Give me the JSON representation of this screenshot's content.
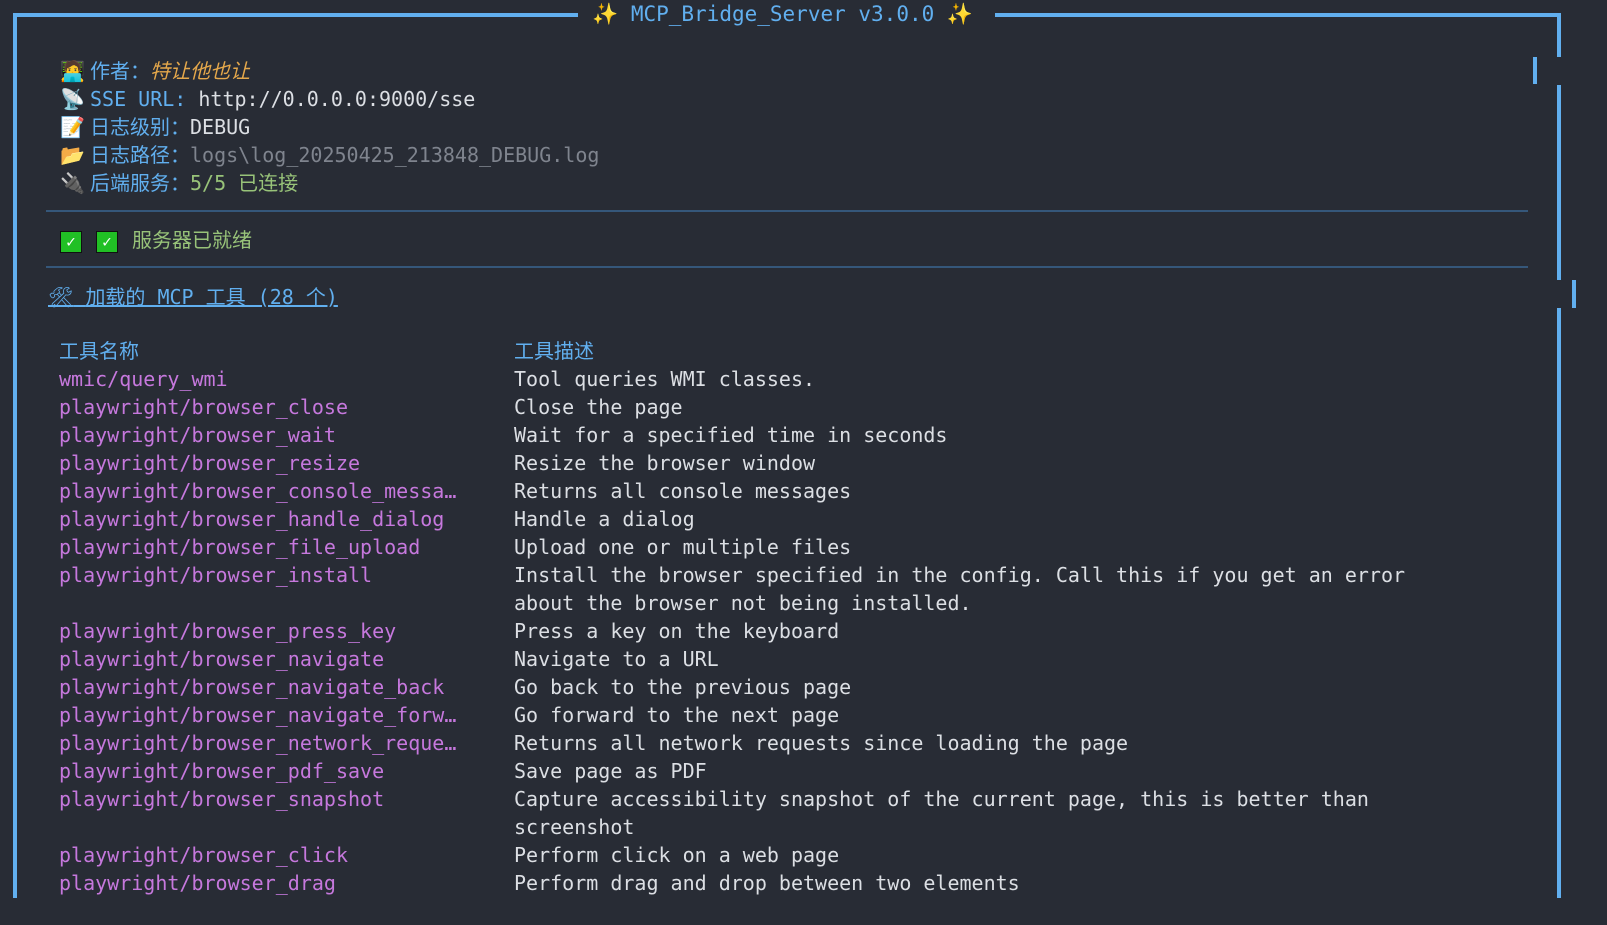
{
  "title": "MCP_Bridge_Server v3.0.0",
  "info": {
    "author_label": "作者：",
    "author": "特让他也让",
    "sse_label": "SSE URL:",
    "sse_url": "http://0.0.0.0:9000/sse",
    "log_level_label": "日志级别：",
    "log_level": "DEBUG",
    "log_path_label": "日志路径：",
    "log_path": "logs\\log_20250425_213848_DEBUG.log",
    "backend_label": "后端服务：",
    "backend_status": "5/5 已连接"
  },
  "status": "服务器已就绪",
  "tools_heading": "加载的 MCP 工具 (28 个)",
  "table": {
    "headers": [
      "工具名称",
      "工具描述"
    ],
    "rows": [
      [
        "wmic/query_wmi",
        "Tool queries WMI classes."
      ],
      [
        "playwright/browser_close",
        "Close the page"
      ],
      [
        "playwright/browser_wait",
        "Wait for a specified time in seconds"
      ],
      [
        "playwright/browser_resize",
        "Resize the browser window"
      ],
      [
        "playwright/browser_console_messa…",
        "Returns all console messages"
      ],
      [
        "playwright/browser_handle_dialog",
        "Handle a dialog"
      ],
      [
        "playwright/browser_file_upload",
        "Upload one or multiple files"
      ],
      [
        "playwright/browser_install",
        "Install the browser specified in the config. Call this if you get an error about the browser not being installed."
      ],
      [
        "playwright/browser_press_key",
        "Press a key on the keyboard"
      ],
      [
        "playwright/browser_navigate",
        "Navigate to a URL"
      ],
      [
        "playwright/browser_navigate_back",
        "Go back to the previous page"
      ],
      [
        "playwright/browser_navigate_forw…",
        "Go forward to the next page"
      ],
      [
        "playwright/browser_network_reque…",
        "Returns all network requests since loading the page"
      ],
      [
        "playwright/browser_pdf_save",
        "Save page as PDF"
      ],
      [
        "playwright/browser_snapshot",
        "Capture accessibility snapshot of the current page, this is better than screenshot"
      ],
      [
        "playwright/browser_click",
        "Perform click on a web page"
      ],
      [
        "playwright/browser_drag",
        "Perform drag and drop between two elements"
      ]
    ]
  }
}
